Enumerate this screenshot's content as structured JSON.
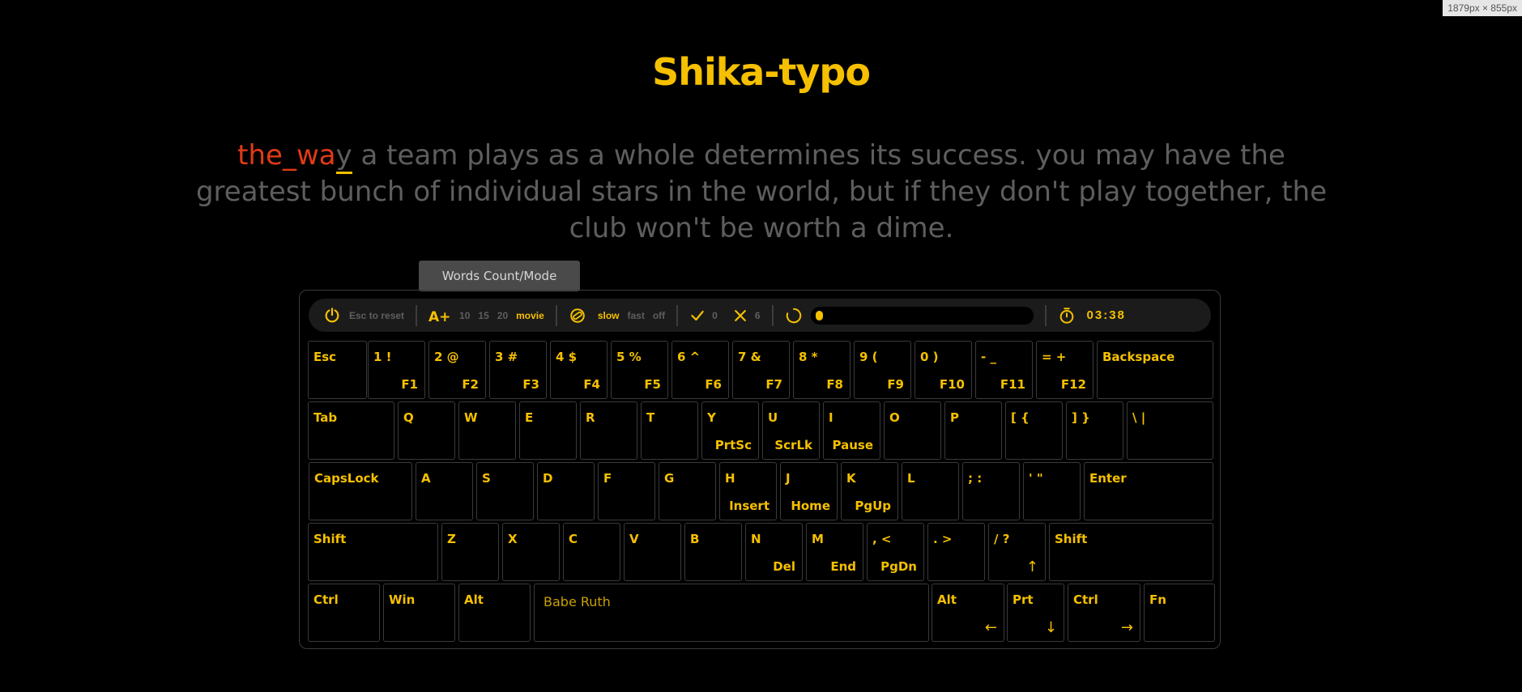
{
  "badge": "1879px × 855px",
  "app": {
    "title": "Shika-typo"
  },
  "passage": {
    "typed": "the_wa",
    "cursor": "y",
    "rest": " a team plays as a whole determines its success. you may have the greatest bunch of individual stars in the world, but if they don't play together, the club won't be worth a dime."
  },
  "tooltip": "Words Count/Mode",
  "toolbar": {
    "reset_label": "Esc to reset",
    "word_counts": [
      "10",
      "15",
      "20"
    ],
    "mode_active": "movie",
    "sound_options": [
      "slow",
      "fast",
      "off"
    ],
    "sound_active": "slow",
    "correct": "0",
    "wrong": "6",
    "progress": 0.02,
    "timer": "03:38"
  },
  "colors": {
    "accent": "#f5c000",
    "error": "#e23a16",
    "muted": "#5e5e5e"
  },
  "icons": {
    "reset": "reset-icon",
    "font": "font-size-icon",
    "sound": "sound-icon",
    "correct": "check-icon",
    "wrong": "x-icon",
    "loading": "spinner-icon",
    "timer": "stopwatch-icon"
  },
  "keyboard": {
    "row1": [
      {
        "main": "Esc",
        "sub": ""
      },
      {
        "main": "1 !",
        "sub": "F1"
      },
      {
        "main": "2 @",
        "sub": "F2"
      },
      {
        "main": "3 #",
        "sub": "F3"
      },
      {
        "main": "4 $",
        "sub": "F4"
      },
      {
        "main": "5 %",
        "sub": "F5"
      },
      {
        "main": "6 ^",
        "sub": "F6"
      },
      {
        "main": "7 &",
        "sub": "F7"
      },
      {
        "main": "8 *",
        "sub": "F8"
      },
      {
        "main": "9 (",
        "sub": "F9"
      },
      {
        "main": "0 )",
        "sub": "F10"
      },
      {
        "main": "- _",
        "sub": "F11"
      },
      {
        "main": "= +",
        "sub": "F12"
      },
      {
        "main": "Backspace",
        "sub": ""
      }
    ],
    "row2": [
      {
        "main": "Tab",
        "sub": ""
      },
      {
        "main": "Q",
        "sub": ""
      },
      {
        "main": "W",
        "sub": ""
      },
      {
        "main": "E",
        "sub": ""
      },
      {
        "main": "R",
        "sub": ""
      },
      {
        "main": "T",
        "sub": ""
      },
      {
        "main": "Y",
        "sub": "PrtSc"
      },
      {
        "main": "U",
        "sub": "ScrLk"
      },
      {
        "main": "I",
        "sub": "Pause"
      },
      {
        "main": "O",
        "sub": ""
      },
      {
        "main": "P",
        "sub": ""
      },
      {
        "main": "[ {",
        "sub": ""
      },
      {
        "main": "] }",
        "sub": ""
      },
      {
        "main": "\\ |",
        "sub": ""
      }
    ],
    "row3": [
      {
        "main": "CapsLock",
        "sub": ""
      },
      {
        "main": "A",
        "sub": ""
      },
      {
        "main": "S",
        "sub": ""
      },
      {
        "main": "D",
        "sub": ""
      },
      {
        "main": "F",
        "sub": ""
      },
      {
        "main": "G",
        "sub": ""
      },
      {
        "main": "H",
        "sub": "Insert"
      },
      {
        "main": "J",
        "sub": "Home"
      },
      {
        "main": "K",
        "sub": "PgUp"
      },
      {
        "main": "L",
        "sub": ""
      },
      {
        "main": "; :",
        "sub": ""
      },
      {
        "main": "' \"",
        "sub": ""
      },
      {
        "main": "Enter",
        "sub": ""
      }
    ],
    "row4": [
      {
        "main": "Shift",
        "sub": ""
      },
      {
        "main": "Z",
        "sub": ""
      },
      {
        "main": "X",
        "sub": ""
      },
      {
        "main": "C",
        "sub": ""
      },
      {
        "main": "V",
        "sub": ""
      },
      {
        "main": "B",
        "sub": ""
      },
      {
        "main": "N",
        "sub": "Del"
      },
      {
        "main": "M",
        "sub": "End"
      },
      {
        "main": ", <",
        "sub": "PgDn"
      },
      {
        "main": ". >",
        "sub": ""
      },
      {
        "main": "/ ?",
        "sub": "↑"
      },
      {
        "main": "Shift",
        "sub": ""
      }
    ],
    "row5": [
      {
        "main": "Ctrl",
        "sub": ""
      },
      {
        "main": "Win",
        "sub": ""
      },
      {
        "main": "Alt",
        "sub": ""
      },
      {
        "main": "Babe Ruth",
        "sub": ""
      },
      {
        "main": "Alt",
        "sub": "←"
      },
      {
        "main": "Prt",
        "sub": "↓"
      },
      {
        "main": "Ctrl",
        "sub": "→"
      },
      {
        "main": "Fn",
        "sub": ""
      }
    ]
  }
}
